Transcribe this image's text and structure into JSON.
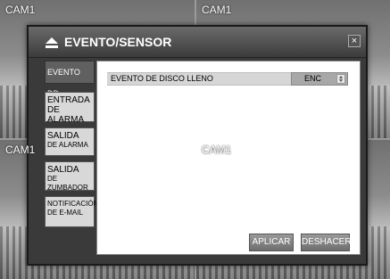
{
  "cameras": [
    {
      "label": "CAM1"
    },
    {
      "label": "CAM1"
    },
    {
      "label": "CAM1"
    },
    {
      "label": "CAM1"
    }
  ],
  "dialog": {
    "title": "EVENTO/SENSOR",
    "close_label": "×",
    "tabs": [
      {
        "main": "EVENTO DD",
        "sub": ""
      },
      {
        "main": "ENTRADA",
        "sub": "DE ALARMA"
      },
      {
        "main": "SALIDA",
        "sub": "DE ALARMA"
      },
      {
        "main": "SALIDA",
        "sub": "DE ZUMBADOR"
      },
      {
        "main": "NOTIFICACIÓN",
        "sub": "DE E-MAIL"
      }
    ],
    "setting": {
      "label": "EVENTO DE DISCO LLENO",
      "value": "ENC"
    },
    "buttons": {
      "apply": "APLICAR",
      "undo": "DESHACER"
    }
  }
}
